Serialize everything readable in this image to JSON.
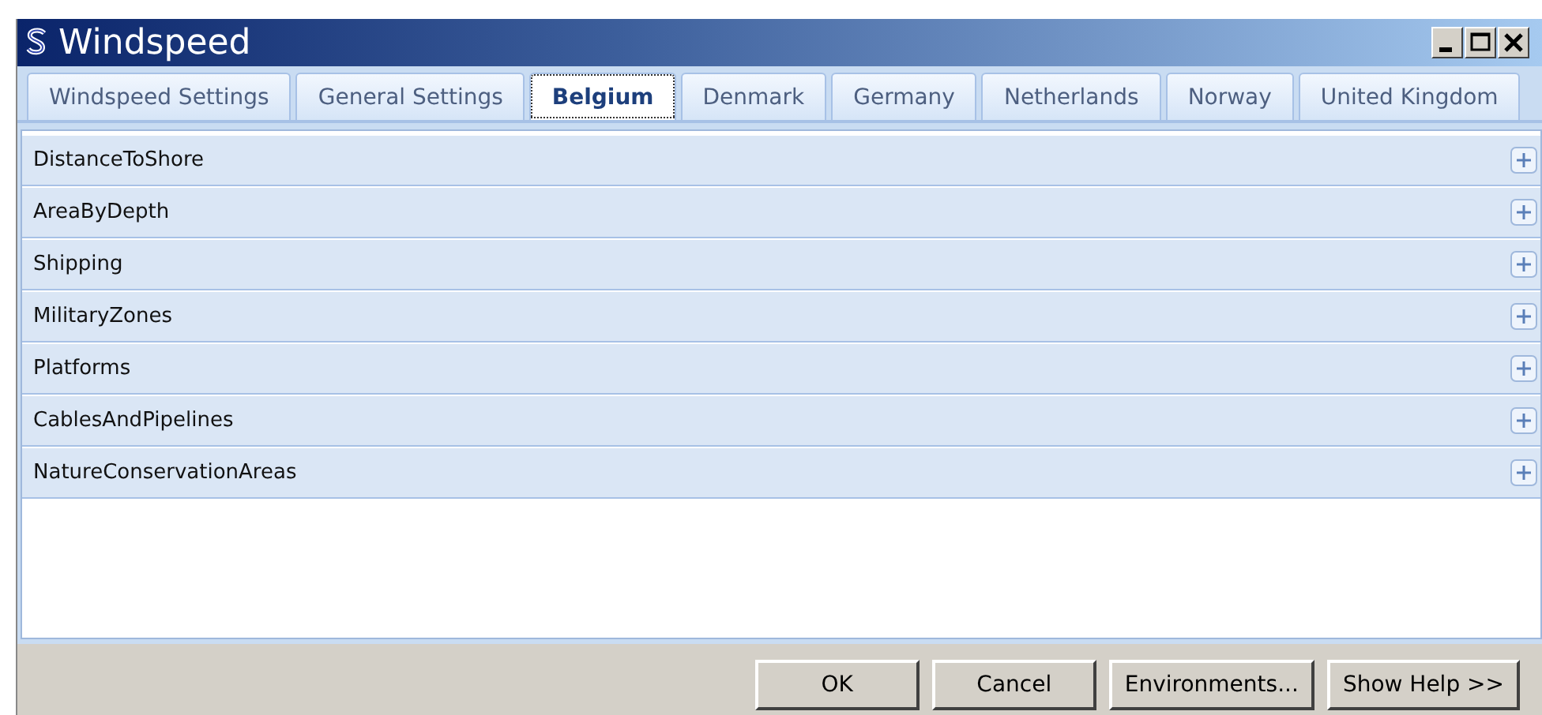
{
  "window": {
    "title": "Windspeed"
  },
  "tabs": [
    {
      "label": "Windspeed Settings",
      "selected": false
    },
    {
      "label": "General Settings",
      "selected": false
    },
    {
      "label": "Belgium",
      "selected": true
    },
    {
      "label": "Denmark",
      "selected": false
    },
    {
      "label": "Germany",
      "selected": false
    },
    {
      "label": "Netherlands",
      "selected": false
    },
    {
      "label": "Norway",
      "selected": false
    },
    {
      "label": "United Kingdom",
      "selected": false
    }
  ],
  "sections": [
    {
      "label": "DistanceToShore",
      "expanded": false
    },
    {
      "label": "AreaByDepth",
      "expanded": false
    },
    {
      "label": "Shipping",
      "expanded": false
    },
    {
      "label": "MilitaryZones",
      "expanded": false
    },
    {
      "label": "Platforms",
      "expanded": false
    },
    {
      "label": "CablesAndPipelines",
      "expanded": false
    },
    {
      "label": "NatureConservationAreas",
      "expanded": false
    }
  ],
  "buttons": [
    "OK",
    "Cancel",
    "Environments...",
    "Show Help >>"
  ]
}
